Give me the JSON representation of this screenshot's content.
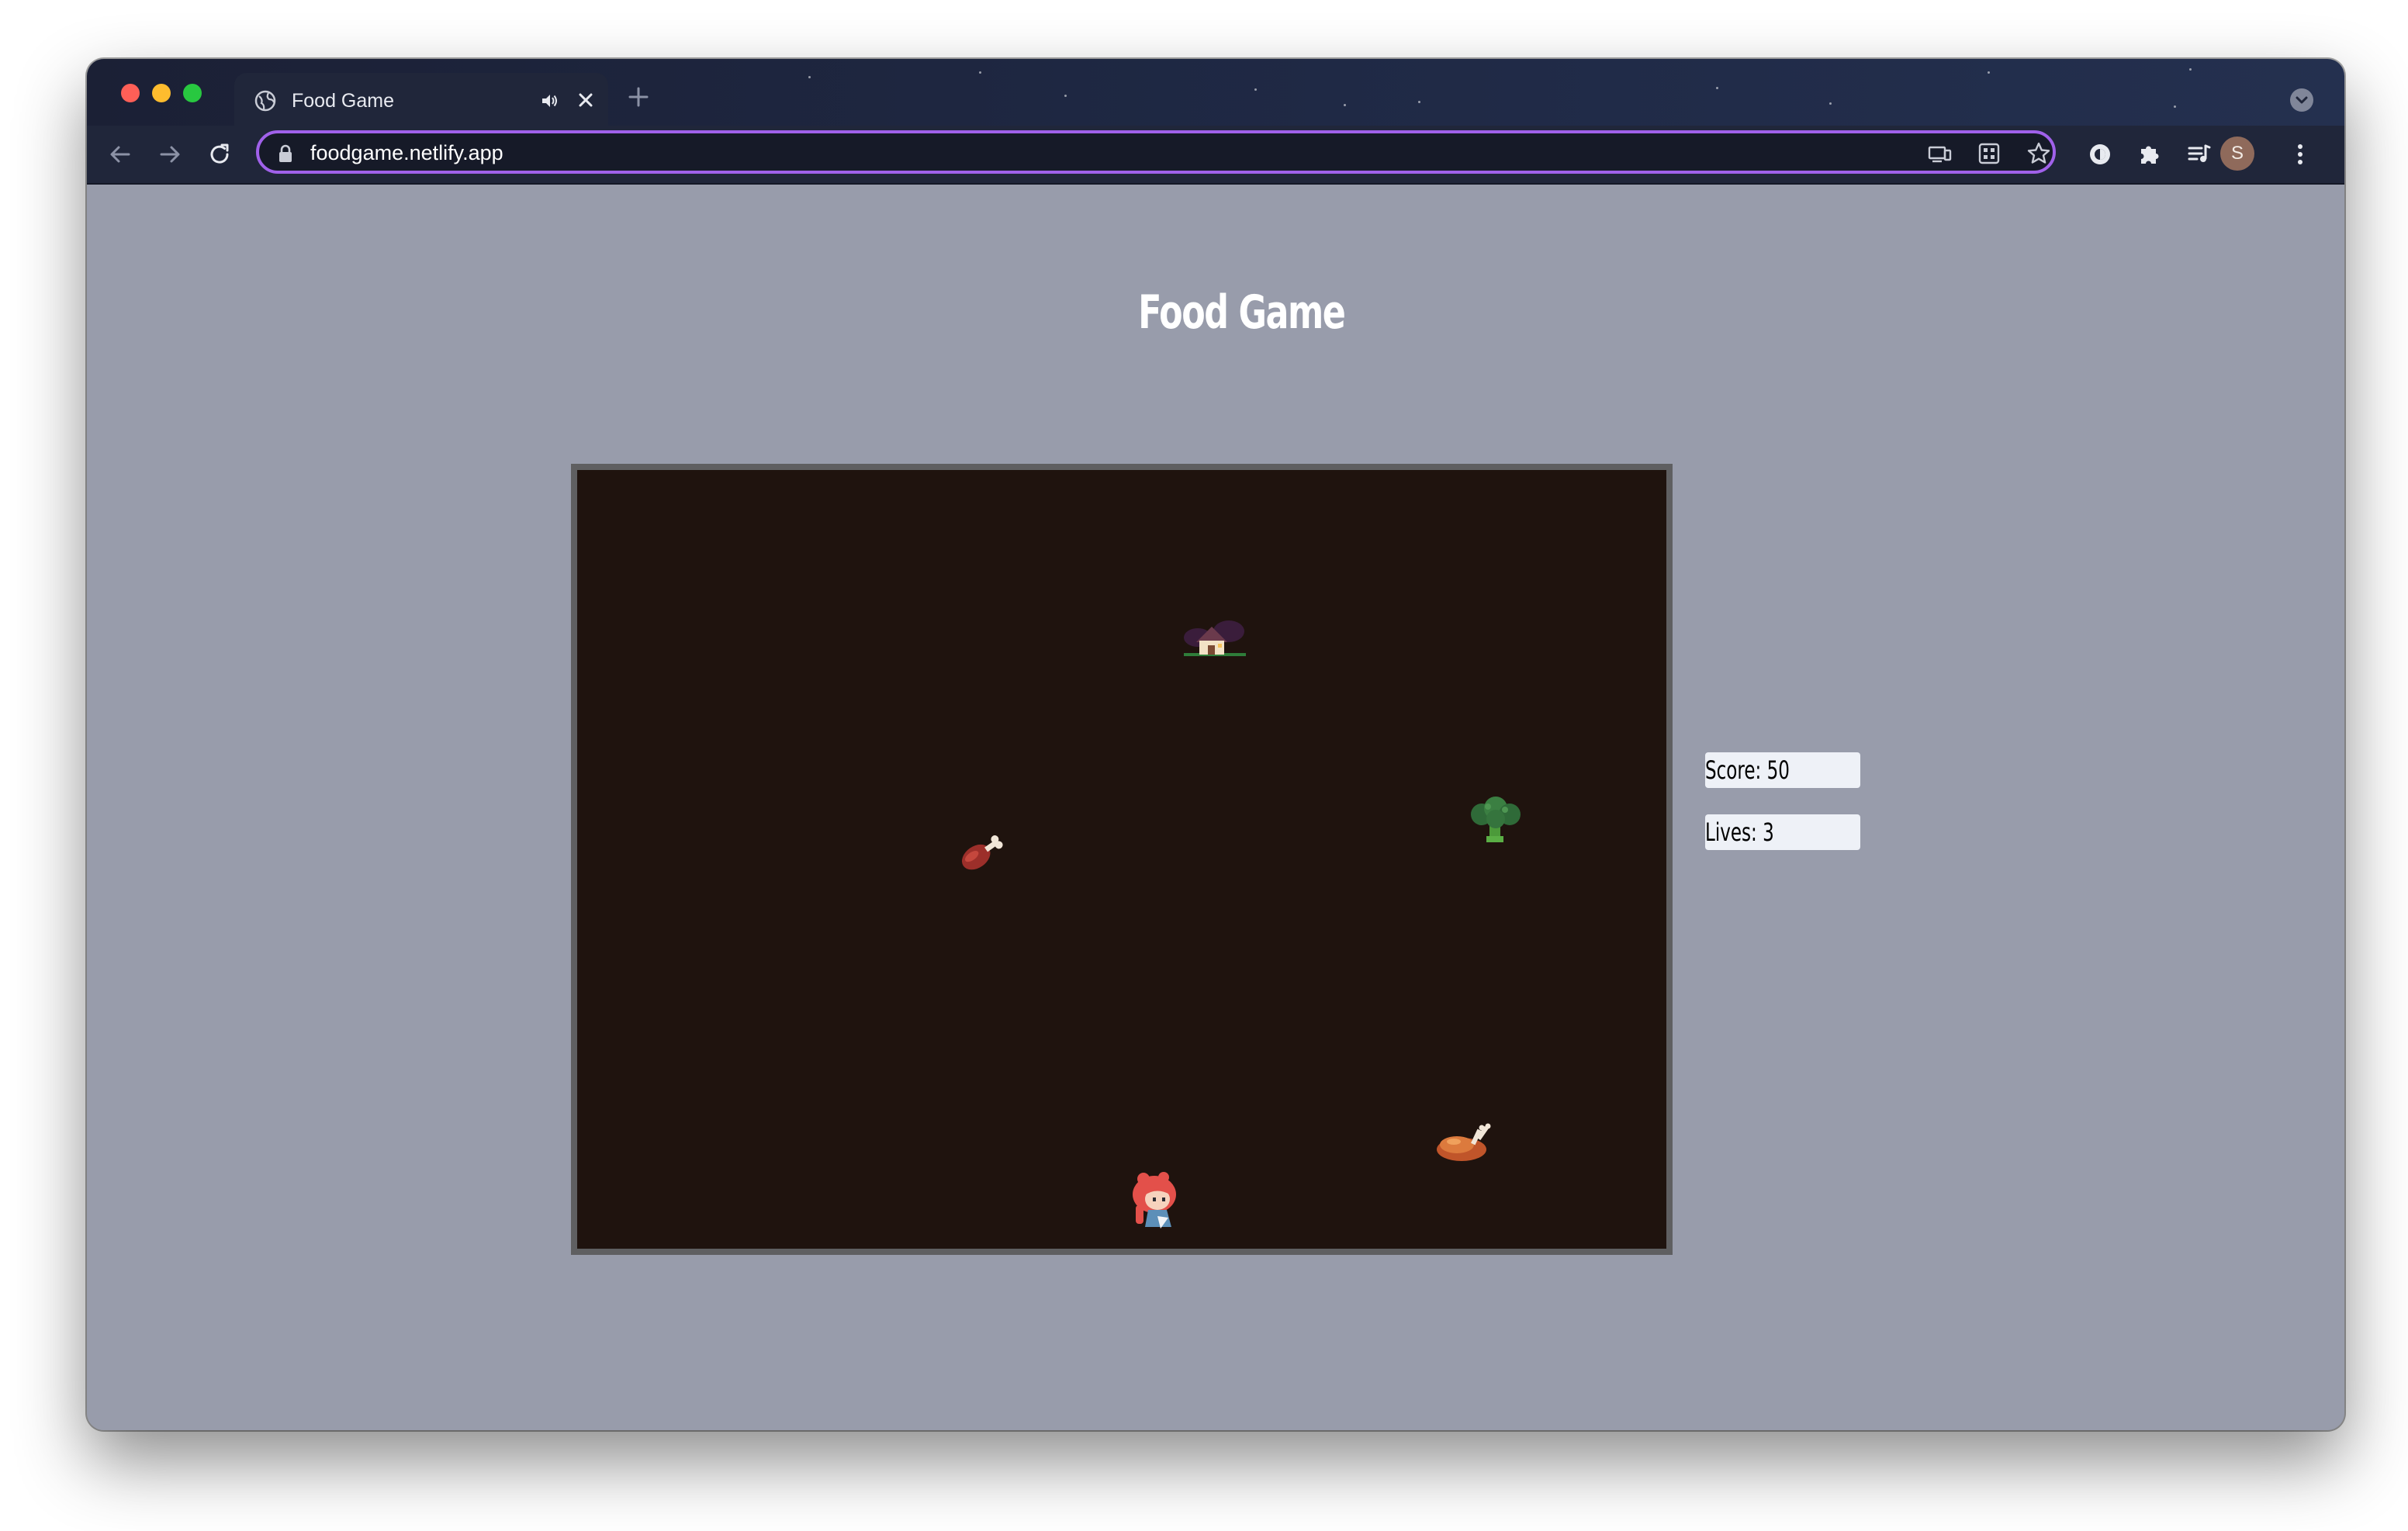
{
  "browser": {
    "tab": {
      "title": "Food Game",
      "favicon": "globe-icon",
      "audio_icon": "speaker-icon",
      "close_icon": "close-icon"
    },
    "new_tab_icon": "plus-icon",
    "tab_search_icon": "chevron-down-icon",
    "nav": {
      "back_icon": "arrow-left-icon",
      "forward_icon": "arrow-right-icon",
      "reload_icon": "reload-icon"
    },
    "address_bar": {
      "lock_icon": "lock-icon",
      "url": "foodgame.netlify.app",
      "accent_color": "#a061ea"
    },
    "omnibox_actions": [
      "cast-icon",
      "apps-icon",
      "bookmark-star-icon"
    ],
    "toolbar_actions": [
      "theme-icon",
      "extensions-icon",
      "media-queue-icon"
    ],
    "profile": {
      "initial": "S",
      "color": "#8f6a5b"
    },
    "menu_icon": "more-vert-icon"
  },
  "page": {
    "background": "#989cab",
    "title": "Food Game",
    "board": {
      "background": "#1f130e",
      "border_color": "#5f5f61",
      "sprites": [
        {
          "name": "house-sprite",
          "kind": "house"
        },
        {
          "name": "broccoli-sprite",
          "kind": "broccoli"
        },
        {
          "name": "meat-sprite",
          "kind": "meat drumstick"
        },
        {
          "name": "roast-chicken-sprite",
          "kind": "roast chicken"
        },
        {
          "name": "player-sprite",
          "kind": "red-haired girl"
        }
      ]
    },
    "hud": {
      "score_text": "Score: 50",
      "lives_text": "Lives: 3",
      "score": 50,
      "lives": 3
    }
  }
}
